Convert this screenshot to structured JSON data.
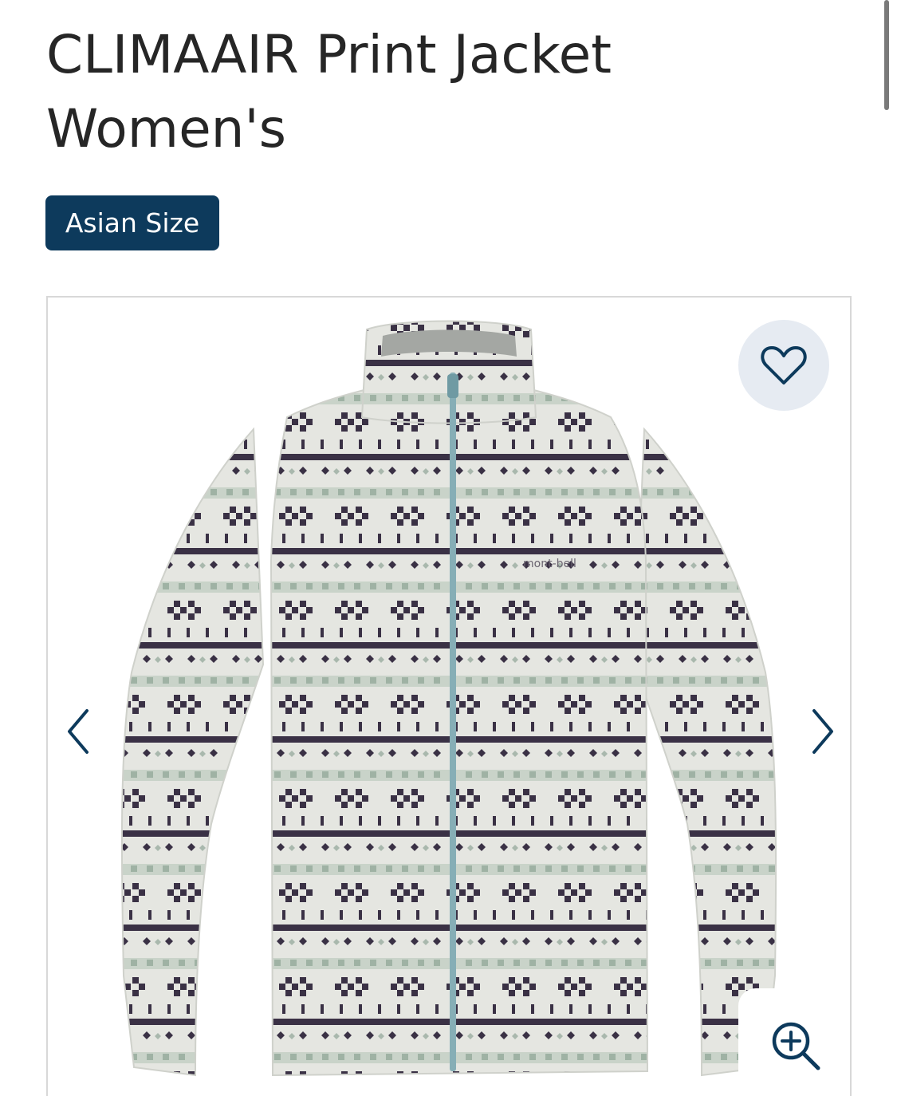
{
  "product": {
    "title": "CLIMAAIR Print Jacket Women's",
    "size_badge": "Asian Size"
  },
  "gallery": {
    "image": "fleece-jacket-image",
    "brand_mark_on_garment": "mont-bell",
    "icons": {
      "favorite": "heart-icon",
      "previous": "chevron-left-icon",
      "next": "chevron-right-icon",
      "zoom": "zoom-in-icon"
    }
  },
  "colors": {
    "badge_background": "#0d3a5c",
    "badge_text": "#ffffff",
    "favorite_background": "#e6ebf2",
    "icon_color": "#0d3a5c",
    "title_color": "#262626",
    "zipper": "#86aeb6",
    "pattern_dark": "#3a3145",
    "pattern_light": "#a9b8ad",
    "fleece_base": "#e5e6e1"
  }
}
